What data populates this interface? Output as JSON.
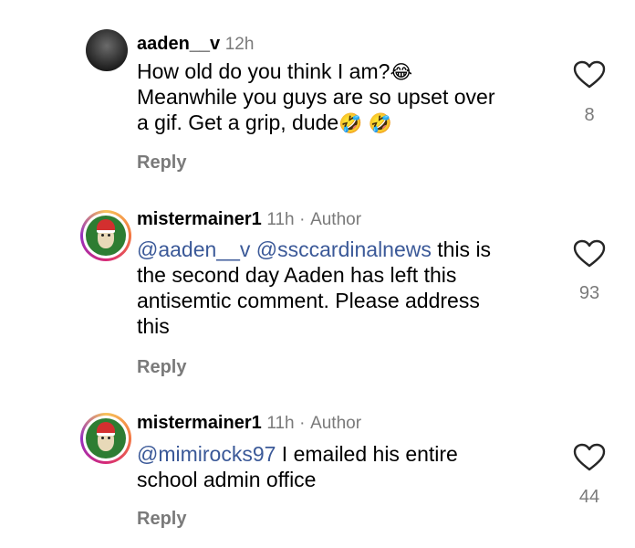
{
  "comments": [
    {
      "username": "aaden__v",
      "time": "12h",
      "author_label": "",
      "text_lines": [
        "How old do you think I am?",
        "Meanwhile you guys are so upset over",
        "a gif. Get a grip, dude"
      ],
      "emoji_laugh": "😂",
      "emoji_rofl": "🤣",
      "reply_label": "Reply",
      "like_count": "8"
    },
    {
      "username": "mistermainer1",
      "time": "11h",
      "separator": "·",
      "author_label": "Author",
      "mention1": "@aaden__v",
      "mention2": "@ssccardinalnews",
      "text_after_mentions": " this is",
      "text_lines": [
        "the second day Aaden has left this",
        "antisemtic comment. Please address",
        "this"
      ],
      "reply_label": "Reply",
      "like_count": "93"
    },
    {
      "username": "mistermainer1",
      "time": "11h",
      "separator": "·",
      "author_label": "Author",
      "mention1": "@mimirocks97",
      "text_after_mentions": " I emailed his entire",
      "text_lines": [
        "school admin office"
      ],
      "reply_label": "Reply",
      "like_count": "44"
    }
  ],
  "icons": {
    "like": "heart-outline-icon"
  },
  "colors": {
    "mention": "#3b5998",
    "meta": "#7a7a7a"
  }
}
